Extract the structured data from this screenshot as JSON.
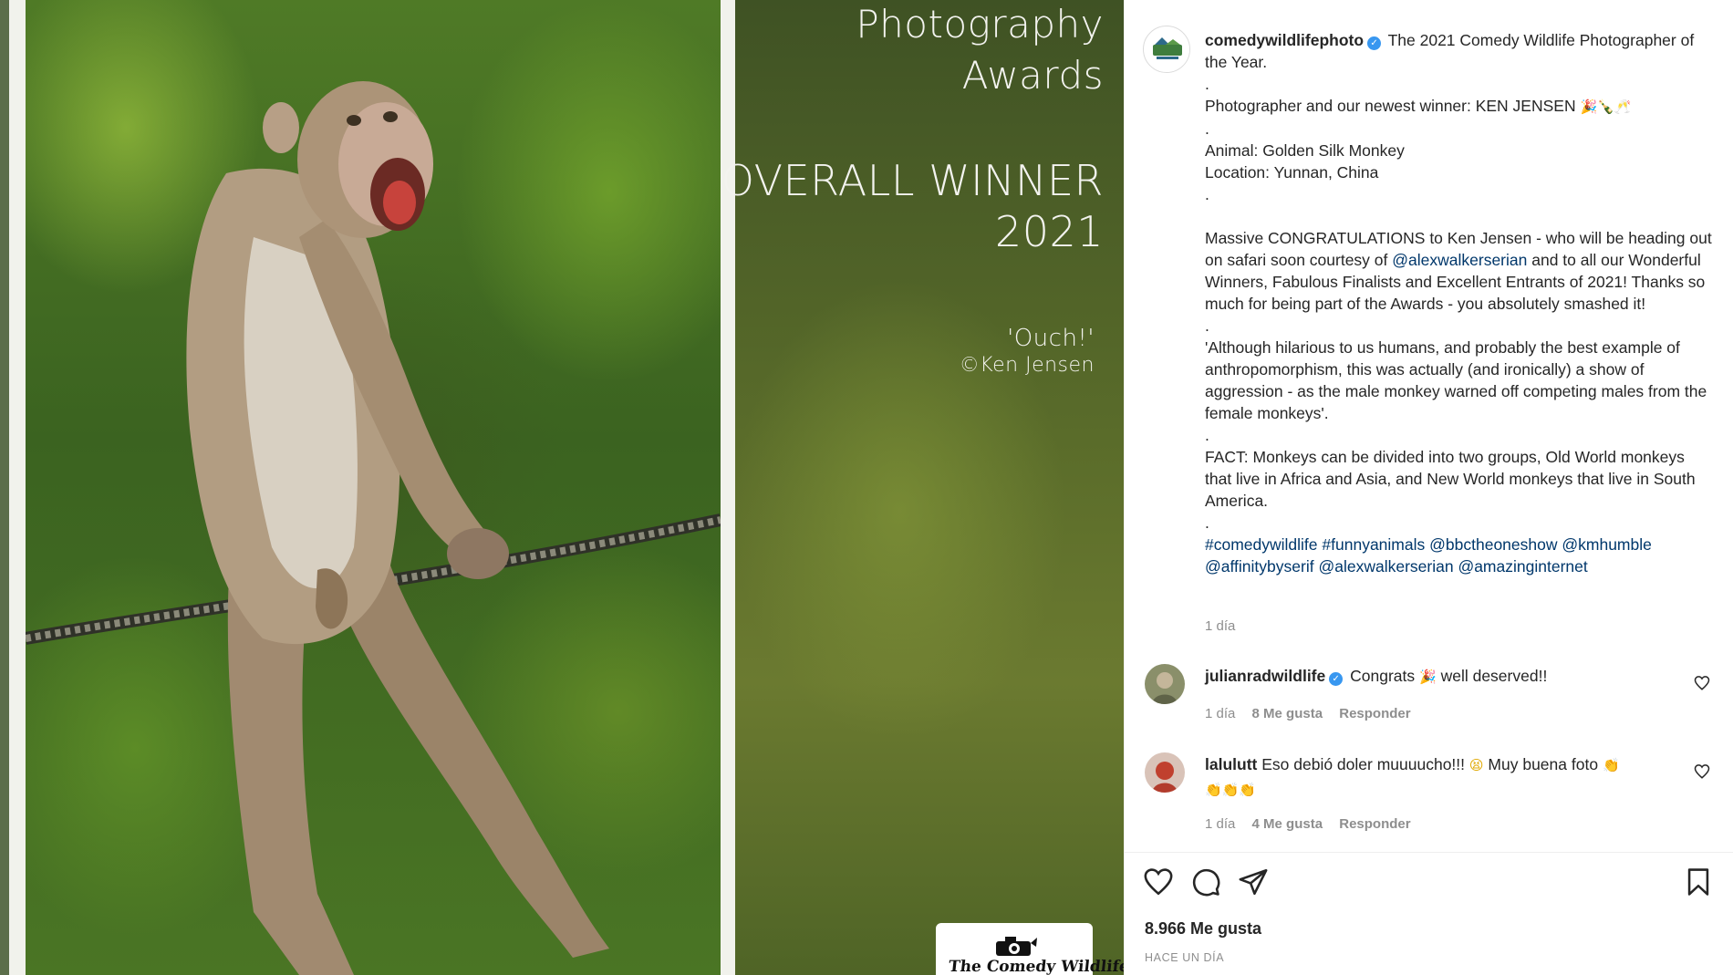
{
  "photo": {
    "award_line1": "Photography",
    "award_line2": "Awards",
    "award_winner": "OVERALL WINNER",
    "award_year": "2021",
    "photo_title": "'Ouch!'",
    "photo_credit": "©Ken Jensen",
    "logo_text": "The Comedy Wildlife"
  },
  "post": {
    "author": "comedywildlifephoto",
    "caption_intro": "The 2021 Comedy Wildlife Photographer of the Year.",
    "dot": ".",
    "winner_line": "Photographer and our newest winner: KEN JENSEN",
    "animal": "Animal: Golden Silk Monkey",
    "location": "Location: Yunnan, China",
    "congrats_part1": "Massive CONGRATULATIONS to Ken Jensen - who will be heading out on safari soon courtesy of",
    "congrats_mention": "@alexwalkerserian",
    "congrats_part2": "and to all our Wonderful Winners, Fabulous Finalists and Excellent Entrants of 2021! Thanks so much for being part of the Awards - you absolutely smashed it!",
    "quote": "'Although hilarious to us humans, and probably the best example of anthropomorphism, this was actually (and ironically) a show of aggression - as the male monkey warned off competing males from the female monkeys'.",
    "fact": "FACT: Monkeys can be divided into two groups, Old World monkeys that live in Africa and Asia, and New World monkeys that live in South America.",
    "tags": [
      "#comedywildlife",
      "#funnyanimals",
      "@bbctheoneshow",
      "@kmhumble",
      "@affinitybyserif",
      "@alexwalkerserian",
      "@amazinginternet"
    ],
    "caption_time": "1 día"
  },
  "comments": [
    {
      "username": "julianradwildlife",
      "text": "Congrats",
      "text_after": "well deserved!!",
      "time": "1 día",
      "likes": "8 Me gusta",
      "reply": "Responder"
    },
    {
      "username": "lalulutt",
      "text": "Eso debió doler muuuucho!!!",
      "text_after": "Muy buena foto",
      "time": "1 día",
      "likes": "4 Me gusta",
      "reply": "Responder"
    }
  ],
  "footer": {
    "likes": "8.966 Me gusta",
    "posted": "HACE UN DÍA"
  },
  "icons": {
    "like": "heart-icon",
    "comment": "comment-icon",
    "share": "share-icon",
    "save": "bookmark-icon",
    "verified": "verified-badge-icon"
  }
}
